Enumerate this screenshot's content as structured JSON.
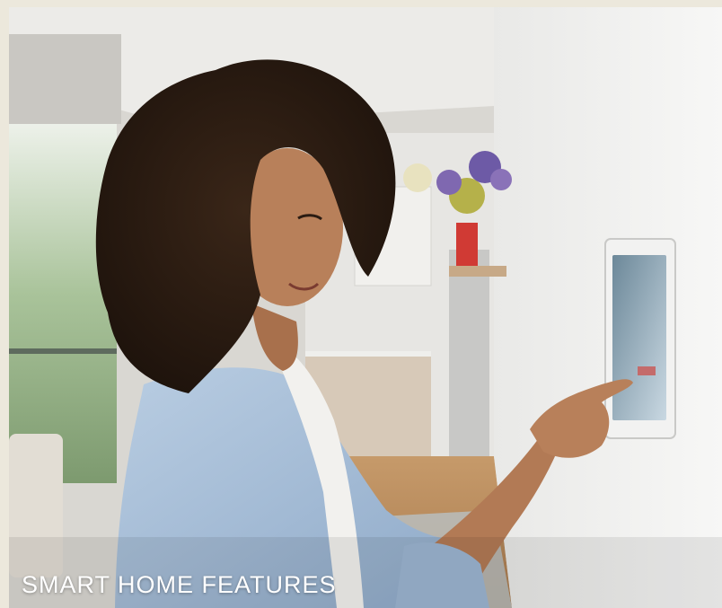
{
  "caption": "SMART HOME FEATURES",
  "photo": {
    "subject": "woman-touching-wall-tablet",
    "colors": {
      "frame": "#ece8dc",
      "wall": "#f1f1f0",
      "shirt": "#a9bfd8",
      "hair": "#2a1b12",
      "skin": "#b27a55",
      "tablet_screen": "#9fb7c6",
      "caption_text": "#ffffff"
    }
  }
}
